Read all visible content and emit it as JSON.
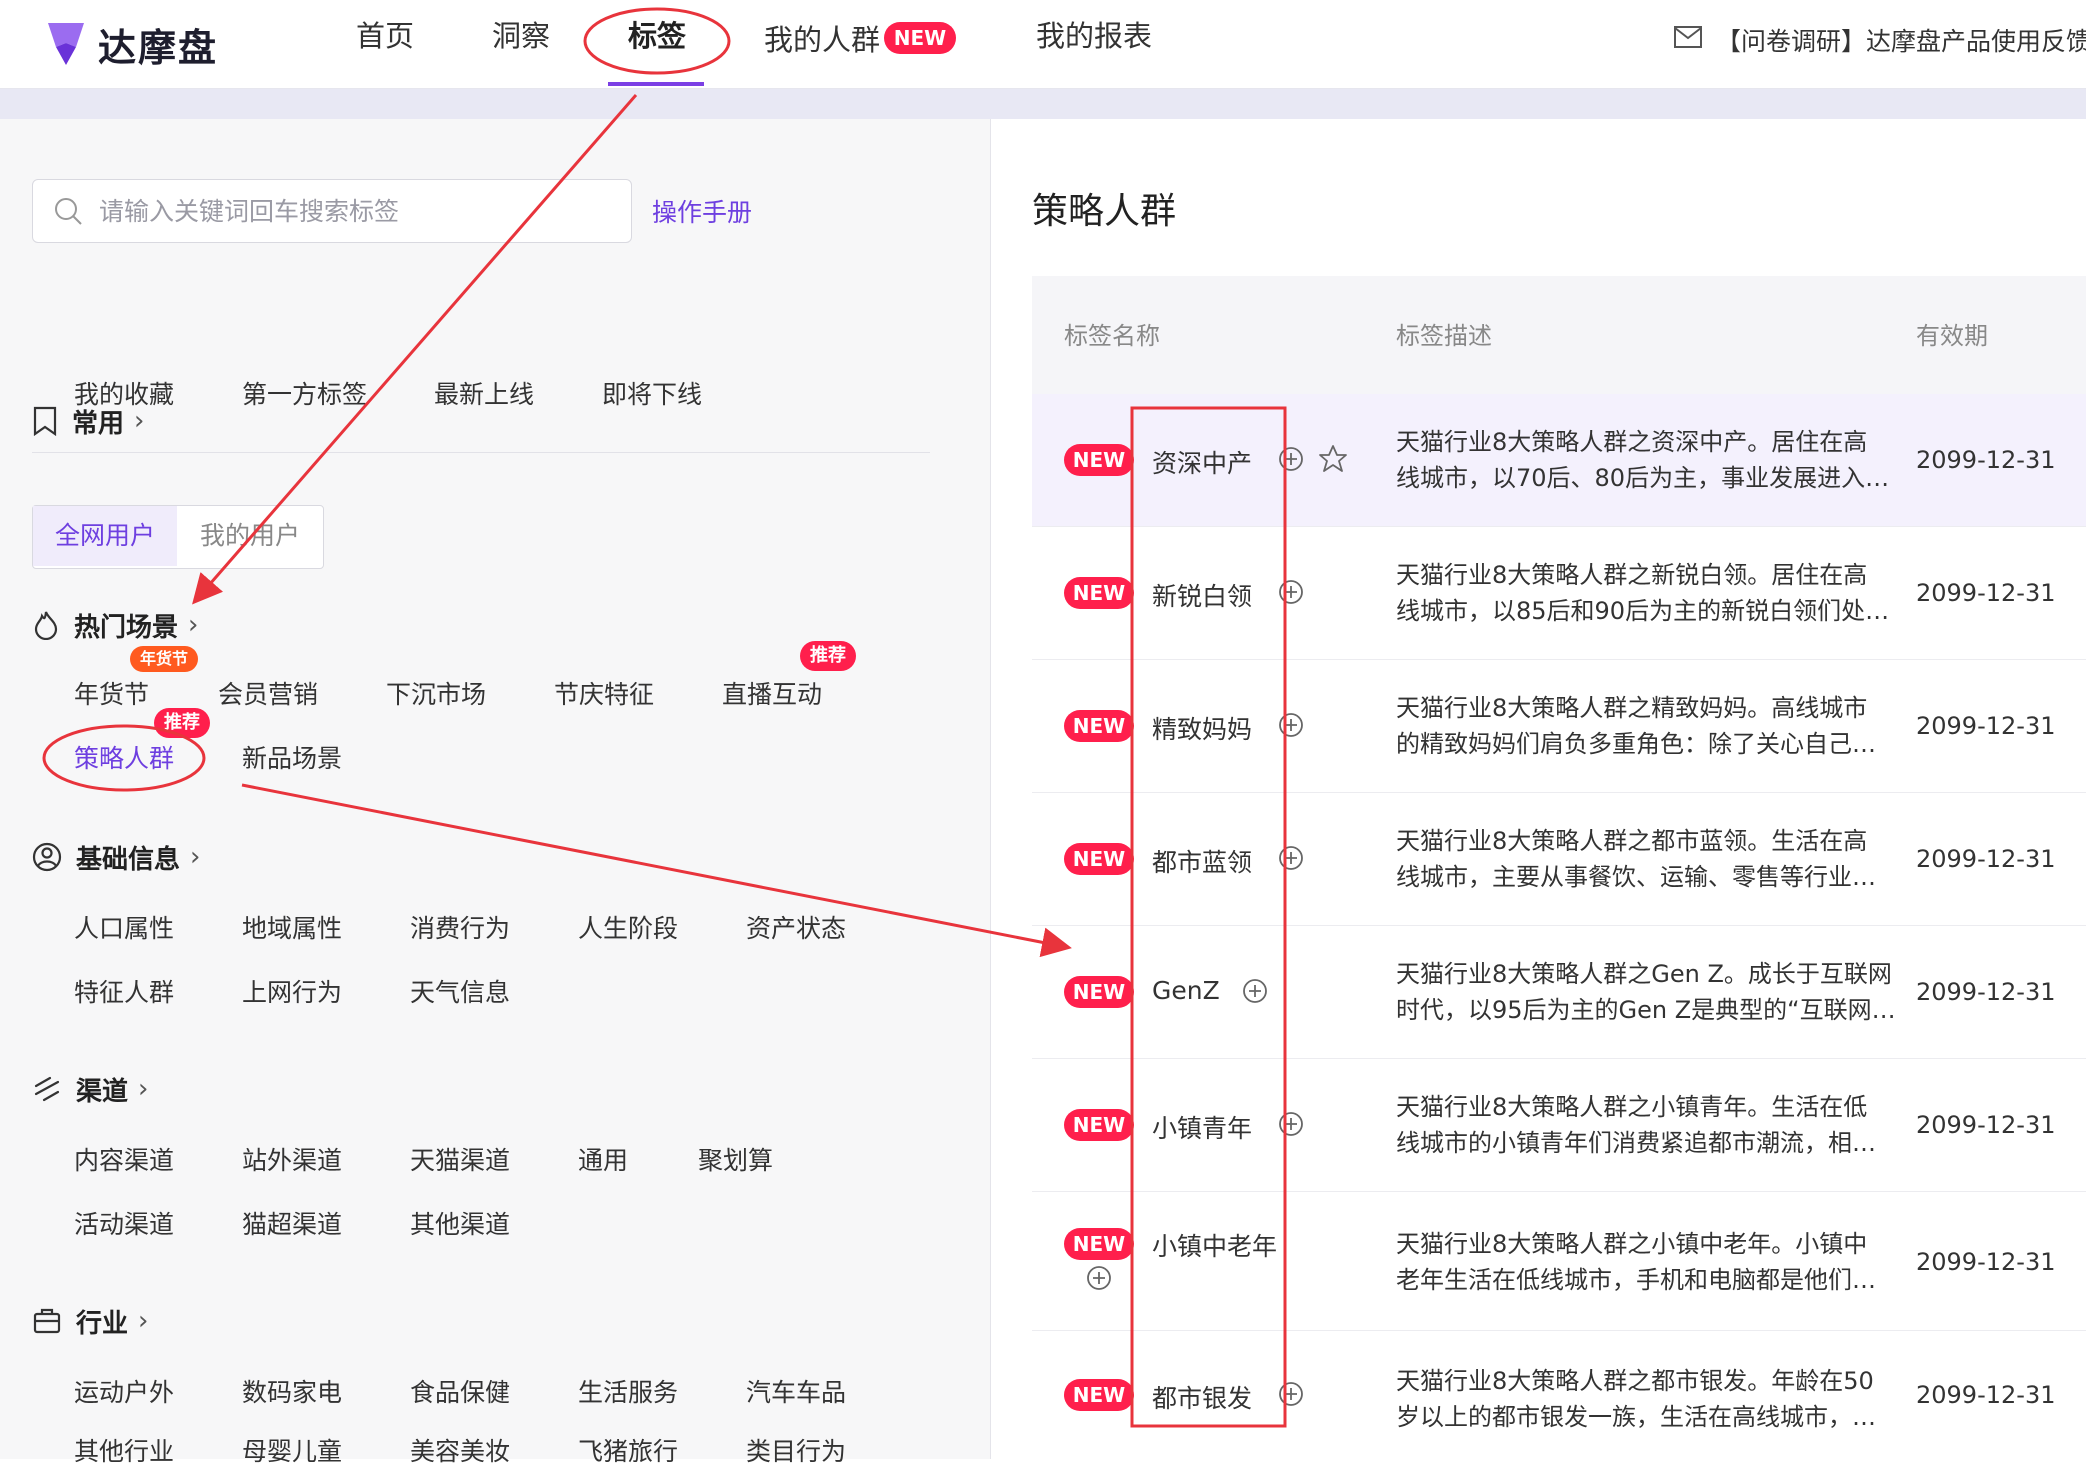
{
  "brand": {
    "name": "达摩盘"
  },
  "nav": {
    "items": [
      "首页",
      "洞察",
      "标签",
      "我的人群",
      "我的报表"
    ],
    "new_badge": "NEW",
    "notice": "【问卷调研】达摩盘产品使用反馈问"
  },
  "search": {
    "placeholder": "请输入关键词回车搜索标签",
    "manual": "操作手册"
  },
  "sections": {
    "common": {
      "title": "常用",
      "items": [
        "我的收藏",
        "第一方标签",
        "最新上线",
        "即将下线"
      ]
    },
    "user_scope": {
      "options": [
        "全网用户",
        "我的用户"
      ]
    },
    "hot": {
      "title": "热门场景",
      "items": [
        "年货节",
        "会员营销",
        "下沉市场",
        "节庆特征",
        "直播互动",
        "策略人群",
        "新品场景"
      ],
      "pills": {
        "nianhuo": "年货节",
        "zhibo": "推荐",
        "celue": "推荐"
      }
    },
    "basic": {
      "title": "基础信息",
      "items": [
        "人口属性",
        "地域属性",
        "消费行为",
        "人生阶段",
        "资产状态",
        "特征人群",
        "上网行为",
        "天气信息"
      ]
    },
    "channel": {
      "title": "渠道",
      "items": [
        "内容渠道",
        "站外渠道",
        "天猫渠道",
        "通用",
        "聚划算",
        "活动渠道",
        "猫超渠道",
        "其他渠道"
      ]
    },
    "industry": {
      "title": "行业",
      "items": [
        "运动户外",
        "数码家电",
        "食品保健",
        "生活服务",
        "汽车车品",
        "其他行业",
        "母婴儿童",
        "美容美妆",
        "飞猪旅行",
        "类目行为"
      ]
    }
  },
  "panel": {
    "title": "策略人群",
    "columns": [
      "标签名称",
      "标签描述",
      "有效期"
    ],
    "badge": "NEW",
    "rows": [
      {
        "name": "资深中产",
        "desc1": "天猫行业8大策略人群之资深中产。居住在高",
        "desc2": "线城市，以70后、80后为主，事业发展进入…",
        "date": "2099-12-31"
      },
      {
        "name": "新锐白领",
        "desc1": "天猫行业8大策略人群之新锐白领。居住在高",
        "desc2": "线城市，以85后和90后为主的新锐白领们处…",
        "date": "2099-12-31"
      },
      {
        "name": "精致妈妈",
        "desc1": "天猫行业8大策略人群之精致妈妈。高线城市",
        "desc2": "的精致妈妈们肩负多重角色：除了关心自己…",
        "date": "2099-12-31"
      },
      {
        "name": "都市蓝领",
        "desc1": "天猫行业8大策略人群之都市蓝领。生活在高",
        "desc2": "线城市，主要从事餐饮、运输、零售等行业…",
        "date": "2099-12-31"
      },
      {
        "name": "GenZ",
        "desc1": "天猫行业8大策略人群之Gen Z。成长于互联网",
        "desc2": "时代，以95后为主的Gen Z是典型的“互联网…",
        "date": "2099-12-31"
      },
      {
        "name": "小镇青年",
        "desc1": "天猫行业8大策略人群之小镇青年。生活在低",
        "desc2": "线城市的小镇青年们消费紧追都市潮流，相…",
        "date": "2099-12-31"
      },
      {
        "name": "小镇中老年",
        "desc1": "天猫行业8大策略人群之小镇中老年。小镇中",
        "desc2": "老年生活在低线城市，手机和电脑都是他们…",
        "date": "2099-12-31"
      },
      {
        "name": "都市银发",
        "desc1": "天猫行业8大策略人群之都市银发。年龄在50",
        "desc2": "岁以上的都市银发一族，生活在高线城市，…",
        "date": "2099-12-31"
      }
    ]
  },
  "colors": {
    "accent": "#7b3fe4",
    "badge": "#ff1f4c",
    "annotation": "#e8343c",
    "pill_orange": "#ff5a1f"
  }
}
